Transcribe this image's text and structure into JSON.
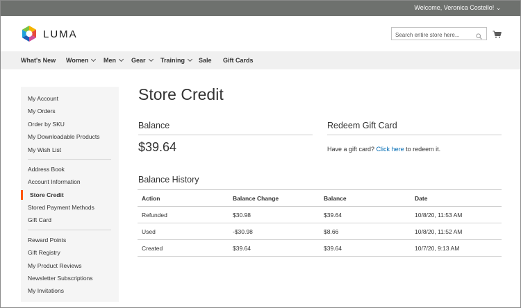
{
  "header": {
    "welcome": "Welcome, Veronica Costello!",
    "brand": "LUMA",
    "search_placeholder": "Search entire store here...",
    "icons": [
      "search-icon",
      "cart-icon",
      "chevron-down-icon"
    ]
  },
  "nav": {
    "items": [
      {
        "label": "What's New",
        "dropdown": false
      },
      {
        "label": "Women",
        "dropdown": true
      },
      {
        "label": "Men",
        "dropdown": true
      },
      {
        "label": "Gear",
        "dropdown": true
      },
      {
        "label": "Training",
        "dropdown": true
      },
      {
        "label": "Sale",
        "dropdown": false
      },
      {
        "label": "Gift Cards",
        "dropdown": false
      }
    ]
  },
  "sidebar": {
    "items": [
      "My Account",
      "My Orders",
      "Order by SKU",
      "My Downloadable Products",
      "My Wish List",
      "Address Book",
      "Account Information",
      "Store Credit",
      "Stored Payment Methods",
      "Gift Card",
      "Reward Points",
      "Gift Registry",
      "My Product Reviews",
      "Newsletter Subscriptions",
      "My Invitations"
    ],
    "active": "Store Credit",
    "accent_color": "#ff5501"
  },
  "main": {
    "title": "Store Credit",
    "balance": {
      "title": "Balance",
      "amount": "$39.64"
    },
    "redeem": {
      "title": "Redeem Gift Card",
      "text_before": "Have a gift card?",
      "link": "Click here",
      "text_after": "to redeem it.",
      "link_color": "#006bb4"
    },
    "history": {
      "title": "Balance History",
      "columns": [
        "Action",
        "Balance Change",
        "Balance",
        "Date"
      ],
      "rows": [
        [
          "Refunded",
          "$30.98",
          "$39.64",
          "10/8/20, 11:53 AM"
        ],
        [
          "Used",
          "-$30.98",
          "$8.66",
          "10/8/20, 11:52 AM"
        ],
        [
          "Created",
          "$39.64",
          "$39.64",
          "10/7/20, 9:13 AM"
        ]
      ]
    }
  }
}
